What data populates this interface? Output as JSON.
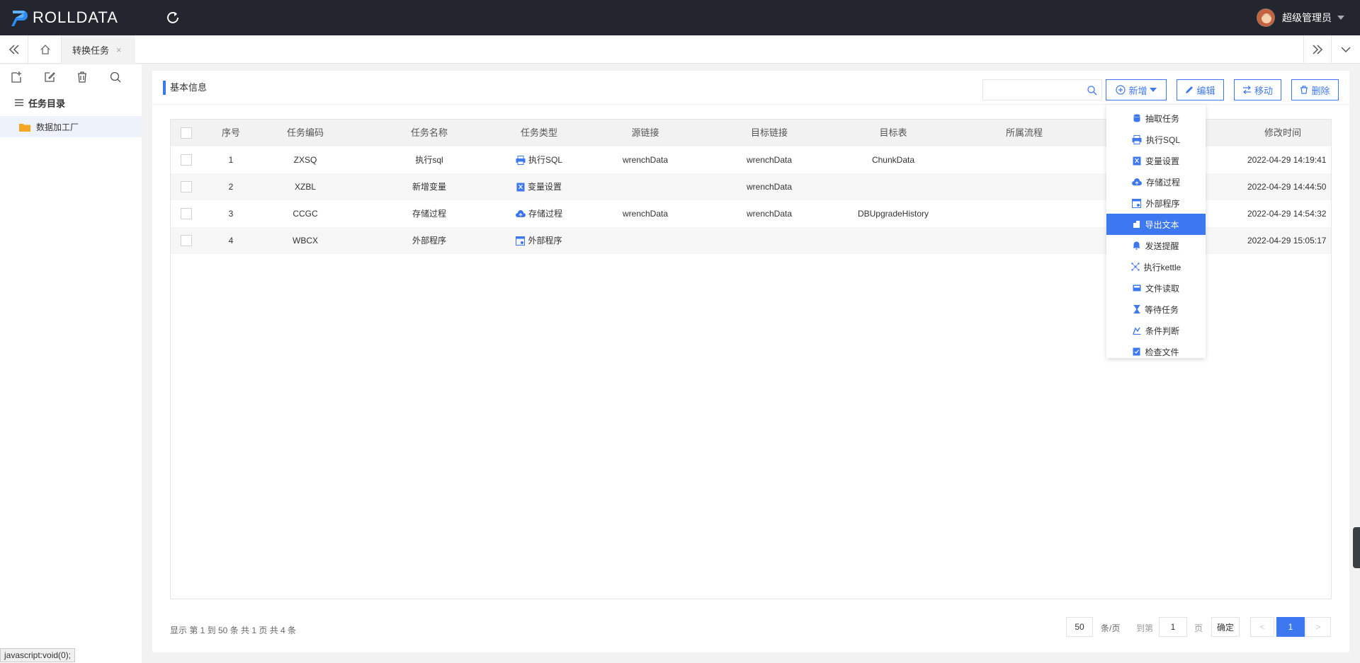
{
  "app": {
    "logo_text": "ROLLDATA",
    "user_name": "超级管理员"
  },
  "tabs": [
    {
      "label": "转换任务",
      "close": "×"
    }
  ],
  "sidebar": {
    "title": "任务目录",
    "items": [
      {
        "label": "数据加工厂"
      }
    ]
  },
  "panel": {
    "title": "基本信息"
  },
  "search": {
    "value": "",
    "placeholder": ""
  },
  "toolbar": {
    "add": "新增",
    "edit": "编辑",
    "move": "移动",
    "delete": "删除"
  },
  "table": {
    "headers": [
      "序号",
      "任务编码",
      "任务名称",
      "任务类型",
      "源链接",
      "目标链接",
      "目标表",
      "所属流程",
      "修改时间"
    ],
    "rows": [
      {
        "no": "1",
        "code": "ZXSQ",
        "name": "执行sql",
        "type": "执行SQL",
        "type_icon": "sql-icon",
        "src": "wrenchData",
        "dst": "wrenchData",
        "table": "ChunkData",
        "flow": "",
        "time": "2022-04-29 14:19:41"
      },
      {
        "no": "2",
        "code": "XZBL",
        "name": "新增变量",
        "type": "变量设置",
        "type_icon": "variable-icon",
        "src": "",
        "dst": "wrenchData",
        "table": "",
        "flow": "",
        "time": "2022-04-29 14:44:50"
      },
      {
        "no": "3",
        "code": "CCGC",
        "name": "存储过程",
        "type": "存储过程",
        "type_icon": "cloud-icon",
        "src": "wrenchData",
        "dst": "wrenchData",
        "table": "DBUpgradeHistory",
        "flow": "",
        "time": "2022-04-29 14:54:32"
      },
      {
        "no": "4",
        "code": "WBCX",
        "name": "外部程序",
        "type": "外部程序",
        "type_icon": "window-icon",
        "src": "",
        "dst": "",
        "table": "",
        "flow": "",
        "time": "2022-04-29 15:05:17"
      }
    ]
  },
  "dropdown": {
    "items": [
      {
        "label": "抽取任务",
        "icon": "database-icon"
      },
      {
        "label": "执行SQL",
        "icon": "sql-icon"
      },
      {
        "label": "变量设置",
        "icon": "variable-icon"
      },
      {
        "label": "存储过程",
        "icon": "cloud-icon"
      },
      {
        "label": "外部程序",
        "icon": "window-icon"
      },
      {
        "label": "导出文本",
        "icon": "export-icon",
        "active": true
      },
      {
        "label": "发送提醒",
        "icon": "bell-icon"
      },
      {
        "label": "执行kettle",
        "icon": "kettle-icon"
      },
      {
        "label": "文件读取",
        "icon": "file-read-icon"
      },
      {
        "label": "等待任务",
        "icon": "hourglass-icon"
      },
      {
        "label": "条件判断",
        "icon": "condition-icon"
      },
      {
        "label": "检查文件",
        "icon": "file-check-icon"
      }
    ]
  },
  "footer": {
    "summary": "显示 第 1 到 50 条 共 1 页 共 4 条",
    "page_size": "50",
    "per_page": "条/页",
    "goto": "到第",
    "goto_value": "1",
    "page_unit": "页",
    "confirm": "确定",
    "prev": "<",
    "current": "1",
    "next": ">"
  },
  "status_bar": "javascript:void(0);",
  "colors": {
    "accent": "#3e78f0",
    "topbar": "#23262e"
  }
}
